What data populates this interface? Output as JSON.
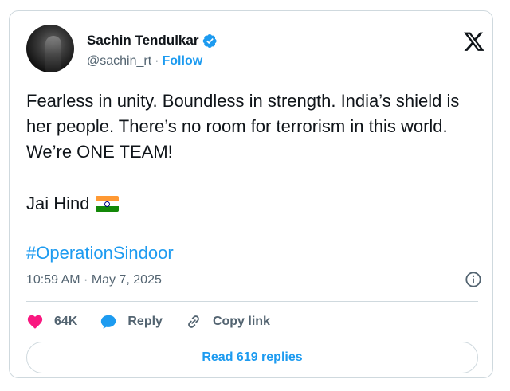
{
  "author": {
    "name": "Sachin Tendulkar",
    "handle": "@sachin_rt",
    "separator": "·",
    "follow_label": "Follow"
  },
  "tweet": {
    "text": "Fearless in unity. Boundless in strength. India’s shield is her people. There’s no room for terrorism in this world. We’re ONE TEAM!",
    "second_line": "Jai Hind",
    "flag_emoji": "indian-flag",
    "hashtag": "#OperationSindoor",
    "timestamp": "10:59 AM · May 7, 2025"
  },
  "actions": {
    "like_count": "64K",
    "reply_label": "Reply",
    "copy_link_label": "Copy link"
  },
  "read_replies_label": "Read 619 replies",
  "icons": [
    "x-logo-icon",
    "verified-badge-icon",
    "heart-icon",
    "reply-bubble-icon",
    "link-icon",
    "info-icon"
  ],
  "colors": {
    "accent": "#1d9bf0",
    "like": "#f91880",
    "muted": "#536471",
    "border": "#cfd9de",
    "text": "#0f1419"
  }
}
